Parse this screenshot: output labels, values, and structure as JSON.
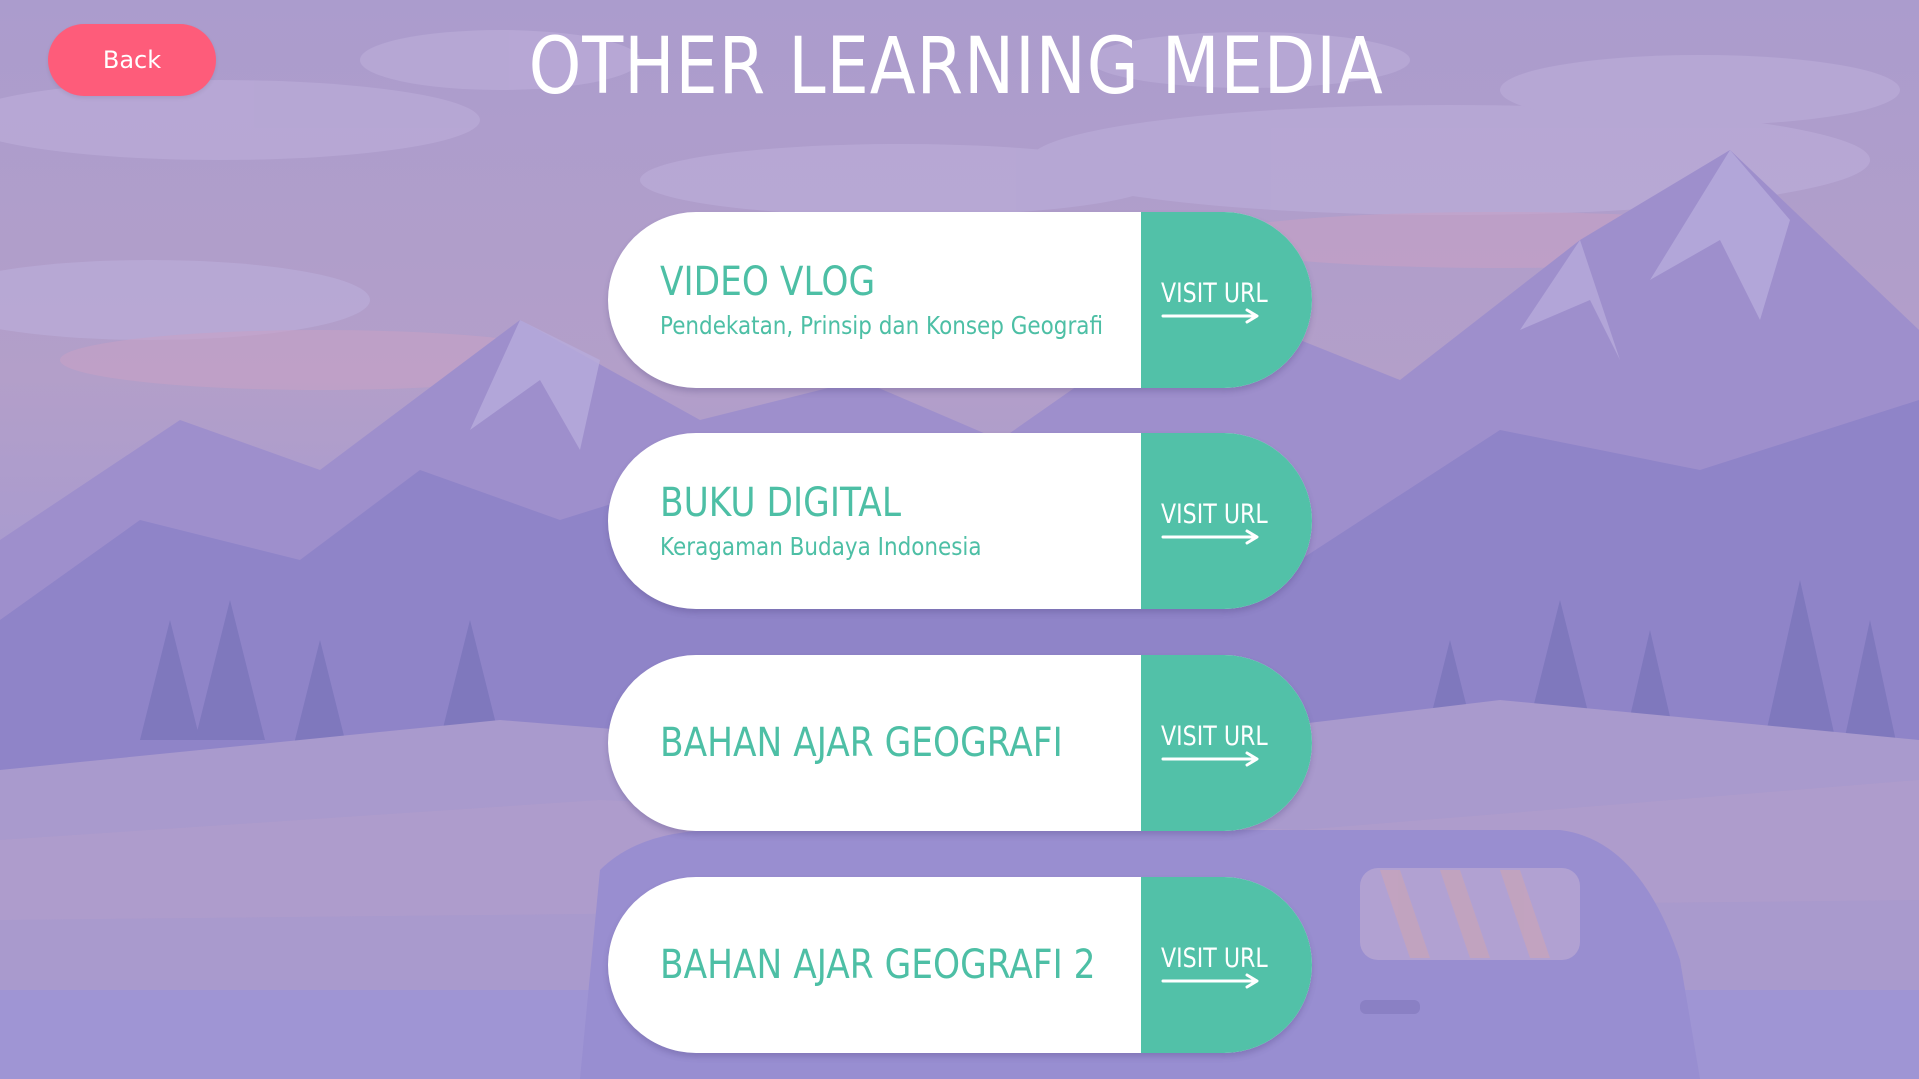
{
  "header": {
    "back_label": "Back",
    "title": "OTHER LEARNING MEDIA"
  },
  "cards": [
    {
      "title": "VIDEO VLOG",
      "subtitle": "Pendekatan, Prinsip dan Konsep Geografi",
      "action_label": "VISIT URL"
    },
    {
      "title": "BUKU DIGITAL",
      "subtitle": "Keragaman Budaya Indonesia",
      "action_label": "VISIT URL"
    },
    {
      "title": "BAHAN AJAR GEOGRAFI",
      "subtitle": "",
      "action_label": "VISIT URL"
    },
    {
      "title": "BAHAN AJAR GEOGRAFI 2",
      "subtitle": "",
      "action_label": "VISIT URL"
    }
  ],
  "colors": {
    "background": "#a99bd0",
    "back_button": "#fe5c7a",
    "accent": "#52c1a8",
    "card_text": "#4dbfa5",
    "card": "#ffffff"
  },
  "icons": {
    "action_icon": "arrow-right-icon"
  }
}
